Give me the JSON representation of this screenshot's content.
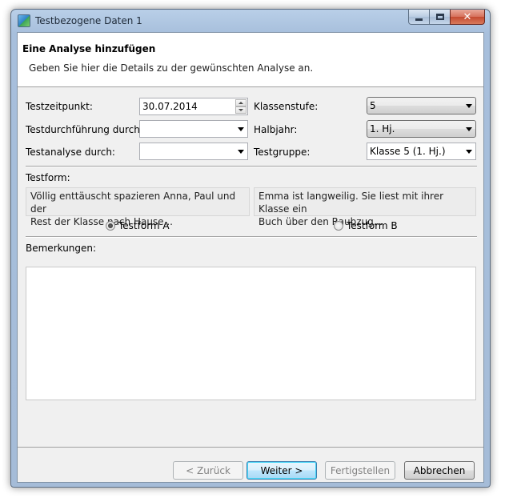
{
  "window": {
    "title": "Testbezogene Daten 1"
  },
  "header": {
    "title": "Eine Analyse hinzufügen",
    "description": "Geben Sie hier die Details zu der gewünschten Analyse an."
  },
  "form": {
    "testzeitpunkt": {
      "label": "Testzeitpunkt:",
      "value": "30.07.2014"
    },
    "testdurchfuehrung": {
      "label": "Testdurchführung durch:",
      "value": ""
    },
    "testanalyse": {
      "label": "Testanalyse durch:",
      "value": ""
    },
    "klassenstufe": {
      "label": "Klassenstufe:",
      "value": "5"
    },
    "halbjahr": {
      "label": "Halbjahr:",
      "value": "1. Hj."
    },
    "testgruppe": {
      "label": "Testgruppe:",
      "value": "Klasse 5 (1. Hj.)"
    }
  },
  "testform": {
    "label": "Testform:",
    "a": {
      "text_line1": "Völlig enttäuscht spazieren Anna, Paul und der",
      "text_line2": "Rest der Klasse nach Hause...",
      "radio_label": "Testform A",
      "selected": true
    },
    "b": {
      "text_line1": "Emma ist langweilig. Sie liest mit ihrer Klasse ein",
      "text_line2": "Buch über den Raubzug...",
      "radio_label": "Testform B",
      "selected": false
    }
  },
  "notes": {
    "label": "Bemerkungen:",
    "value": ""
  },
  "buttons": {
    "back": "< Zurück",
    "next": "Weiter >",
    "finish": "Fertigstellen",
    "cancel": "Abbrechen"
  },
  "icons": [
    "app-icon",
    "minimize-icon",
    "maximize-icon",
    "close-icon",
    "chevron-down-icon",
    "spin-up-icon",
    "spin-down-icon"
  ]
}
